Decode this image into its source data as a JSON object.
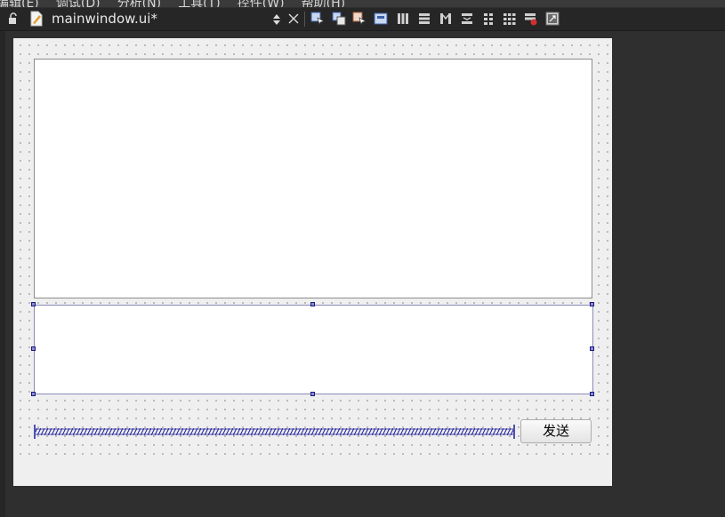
{
  "menubar": {
    "items": [
      "编辑(E)",
      "调试(D)",
      "分析(N)",
      "工具(T)",
      "控件(W)",
      "帮助(H)"
    ]
  },
  "toolbar": {
    "file_name": "mainwindow.ui*",
    "icons": [
      "edit-widgets-icon",
      "edit-signals-slots-icon",
      "edit-buddies-icon",
      "edit-tab-order-icon",
      "layout-horizontal-icon",
      "layout-vertical-icon",
      "layout-horizontal-splitter-icon",
      "layout-vertical-splitter-icon",
      "layout-form-icon",
      "layout-grid-icon",
      "break-layout-icon",
      "adjust-size-icon"
    ]
  },
  "form": {
    "send_button_label": "发送"
  },
  "colors": {
    "background": "#2f2f2f",
    "toolbar": "#262626",
    "form": "#efefef",
    "selection": "#1a1a7a"
  }
}
